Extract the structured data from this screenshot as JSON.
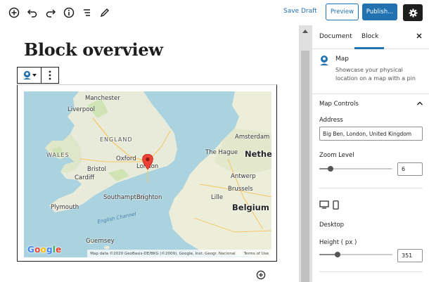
{
  "toolbar": {
    "icons": [
      "add-block-icon",
      "undo-icon",
      "redo-icon",
      "info-icon",
      "list-view-icon",
      "edit-tool-icon"
    ],
    "save_draft_label": "Save Draft",
    "preview_label": "Preview",
    "publish_label": "Publish...",
    "settings_icon": "gear-icon",
    "colors": {
      "accent": "#2271b1",
      "dark": "#1e1e1e"
    }
  },
  "editor": {
    "title": "Block overview",
    "map": {
      "pin_color": "#ea4335",
      "labels": {
        "manchester": "Manchester",
        "liverpool": "Liverpool",
        "england": "ENGLAND",
        "wales": "WALES",
        "bristol": "Bristol",
        "cardiff": "Cardiff",
        "oxford": "Oxford",
        "london": "London",
        "southampton": "Southampton",
        "brighton": "Brighton",
        "plymouth": "Plymouth",
        "guernsey": "Guernsey",
        "english_channel": "English Channel",
        "amsterdam": "Amsterdam",
        "the_hague": "The Hague",
        "nether": "Nether",
        "antwerp": "Antwerp",
        "brussels": "Brussels",
        "belgium": "Belgium",
        "lille": "Lille"
      },
      "google_logo": "Google",
      "attribution": "Map data ©2020 GeoBasis-DE/BKG (©2009), Google, Inst. Geogr. Nacional",
      "terms": "Terms of Use"
    }
  },
  "sidebar": {
    "tabs": {
      "document": "Document",
      "block": "Block"
    },
    "close_icon": "close-icon",
    "block_card": {
      "icon": "map-pin-icon",
      "title": "Map",
      "description": "Showcase your physical location on a map with a pin"
    },
    "map_controls": {
      "title": "Map Controls",
      "address_label": "Address",
      "address_value": "Big Ben, London, United Kingdom",
      "zoom_label": "Zoom Level",
      "zoom_value": "6",
      "zoom_level_fraction": 0.15,
      "device_icons": [
        "desktop-icon",
        "mobile-icon"
      ],
      "device_label": "Desktop",
      "height_label": "Height ( px )",
      "height_value": "351",
      "height_level_fraction": 0.25
    }
  }
}
